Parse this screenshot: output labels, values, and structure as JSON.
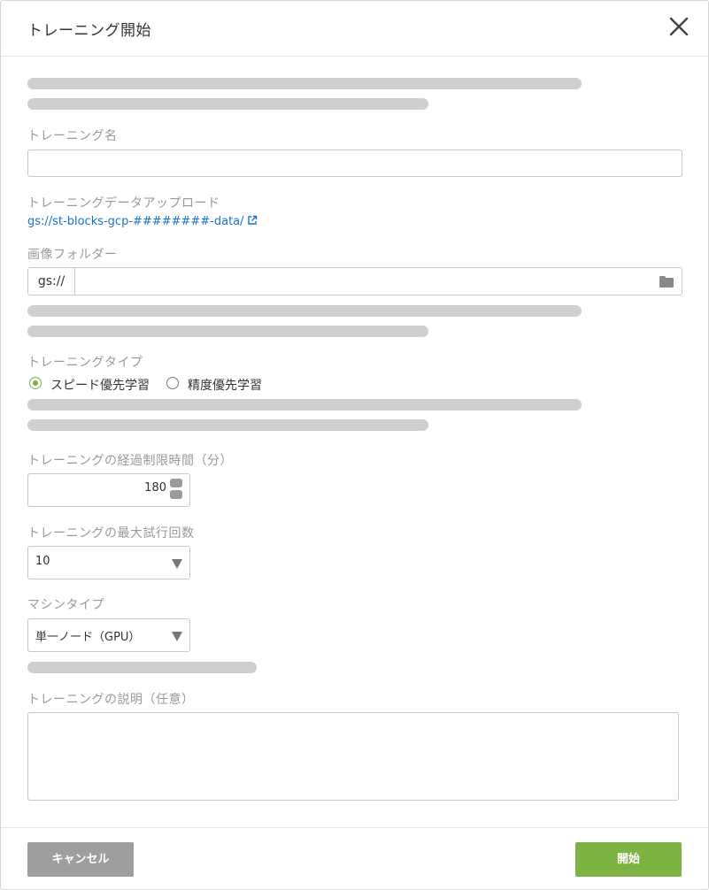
{
  "dialog": {
    "title": "トレーニング開始",
    "close_icon": "close-icon"
  },
  "training_name": {
    "label": "トレーニング名",
    "value": ""
  },
  "training_data": {
    "label": "トレーニングデータアップロード",
    "link_text": "gs://st-blocks-gcp-########-data/",
    "link_icon": "external-link-icon"
  },
  "image_folder": {
    "label": "画像フォルダー",
    "prefix": "gs://",
    "value": "",
    "icon": "folder-icon"
  },
  "training_type": {
    "label": "トレーニングタイプ",
    "options": [
      "スピード優先学習",
      "精度優先学習"
    ],
    "selected": "スピード優先学習"
  },
  "time_limit": {
    "label": "トレーニングの経過制限時間（分）",
    "value": "180"
  },
  "max_trials": {
    "label": "トレーニングの最大試行回数",
    "value": "10"
  },
  "machine_type": {
    "label": "マシンタイプ",
    "value": "単一ノード（GPU）"
  },
  "description": {
    "label": "トレーニングの説明（任意）",
    "value": ""
  },
  "footer": {
    "cancel_label": "キャンセル",
    "start_label": "開始"
  },
  "colors": {
    "primary": "#7cb342",
    "cancel": "#9e9e9e",
    "link": "#1a73c5",
    "skeleton": "#cfcfcf"
  }
}
